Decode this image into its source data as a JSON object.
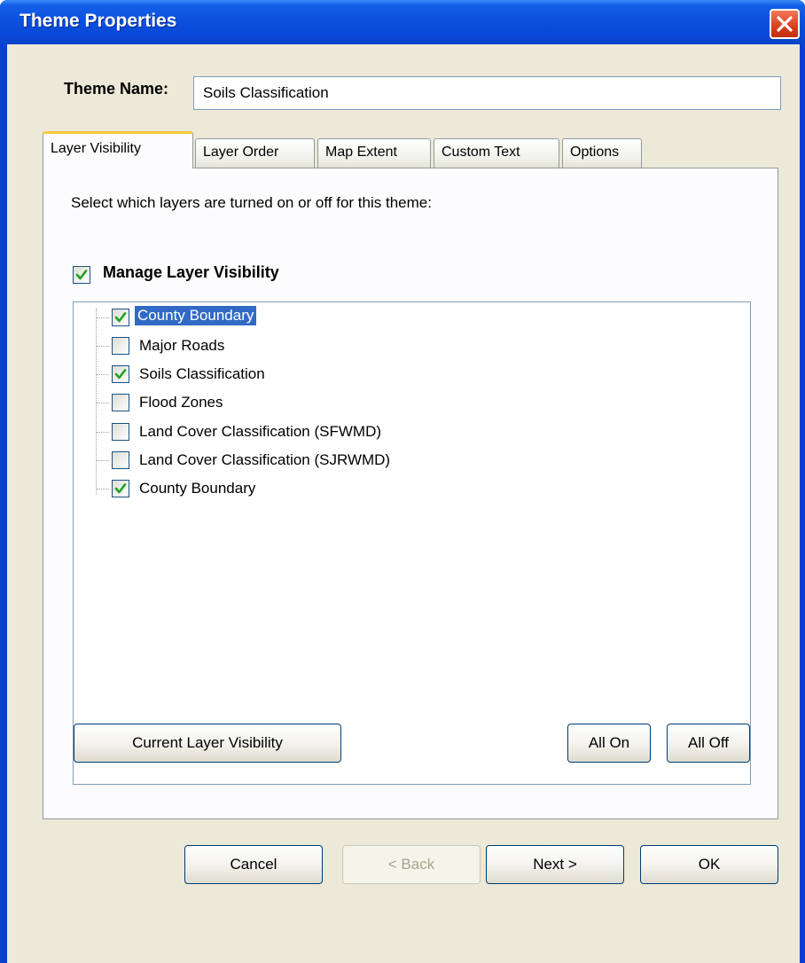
{
  "window": {
    "title": "Theme Properties"
  },
  "theme_name": {
    "label": "Theme Name:",
    "value": "Soils Classification"
  },
  "tabs": [
    {
      "label": "Layer Visibility",
      "active": true
    },
    {
      "label": "Layer Order",
      "active": false
    },
    {
      "label": "Map Extent",
      "active": false
    },
    {
      "label": "Custom Text",
      "active": false
    },
    {
      "label": "Options",
      "active": false
    }
  ],
  "panel": {
    "instructions": "Select which layers are turned on or off for this theme:",
    "manage_label": "Manage Layer Visibility",
    "manage_checked": true
  },
  "layers": [
    {
      "label": "County Boundary",
      "checked": true,
      "selected": true
    },
    {
      "label": "Major Roads",
      "checked": false,
      "selected": false
    },
    {
      "label": "Soils Classification",
      "checked": true,
      "selected": false
    },
    {
      "label": "Flood Zones",
      "checked": false,
      "selected": false
    },
    {
      "label": "Land Cover Classification (SFWMD)",
      "checked": false,
      "selected": false
    },
    {
      "label": "Land Cover Classification (SJRWMD)",
      "checked": false,
      "selected": false
    },
    {
      "label": "County Boundary",
      "checked": true,
      "selected": false
    }
  ],
  "panel_buttons": {
    "current_visibility": "Current Layer Visibility",
    "all_on": "All On",
    "all_off": "All Off"
  },
  "footer_buttons": {
    "cancel": "Cancel",
    "back": "< Back",
    "next": "Next >",
    "ok": "OK"
  },
  "colors": {
    "titlebar": "#0b50df",
    "selection": "#316ac5",
    "check": "#21a121",
    "active_tab_accent": "#ffc73c"
  },
  "icons": {
    "close": "close-icon",
    "checkmark": "checkmark-icon"
  }
}
